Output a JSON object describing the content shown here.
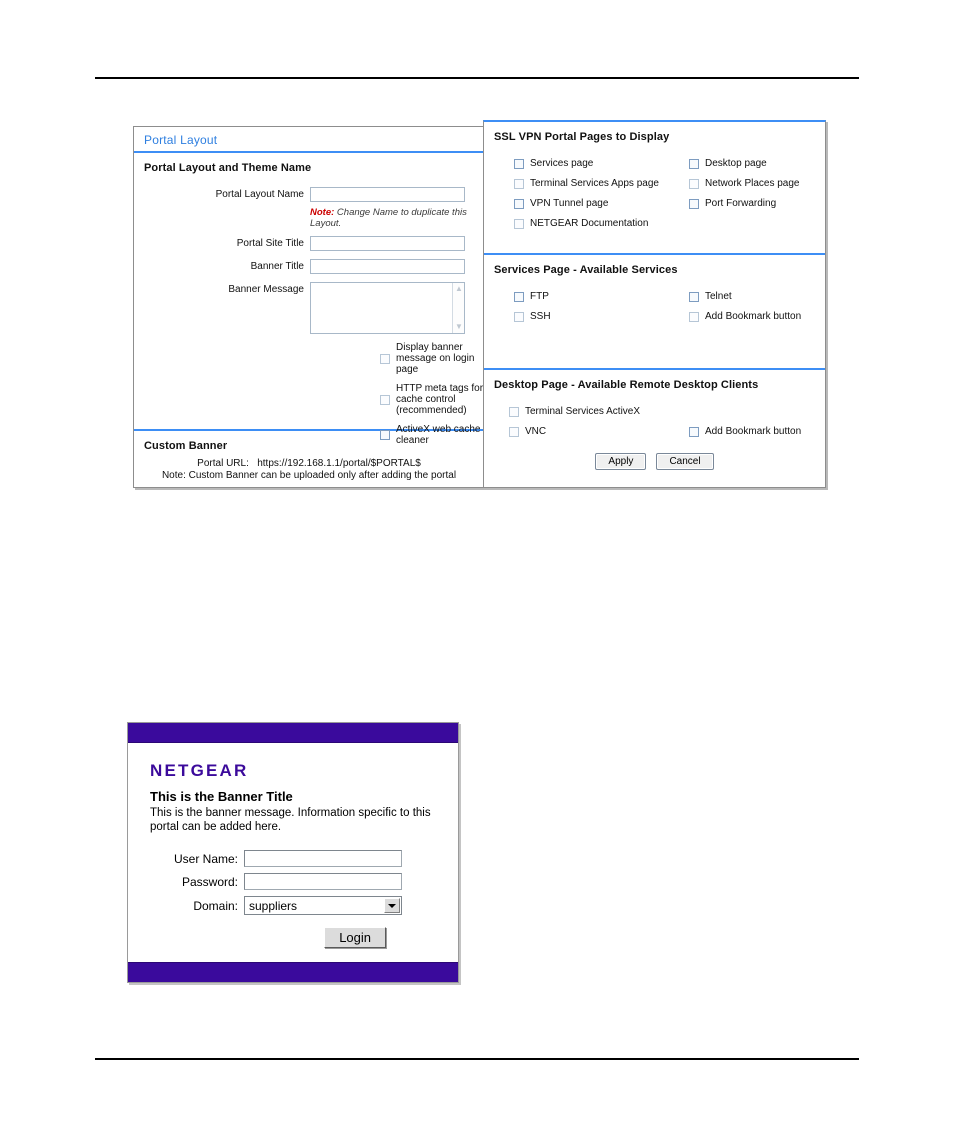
{
  "left_panel": {
    "title": "Portal Layout",
    "sections": [
      {
        "title": "Portal Layout and Theme Name",
        "fields": [
          {
            "label": "Portal Layout Name",
            "value": "",
            "type": "text"
          },
          {
            "label": "Portal Site Title",
            "value": "",
            "type": "text"
          },
          {
            "label": "Banner Title",
            "value": "",
            "type": "text"
          },
          {
            "label": "Banner Message",
            "value": "",
            "type": "textarea"
          }
        ],
        "note_keyword": "Note:",
        "note_text": "Change Name to duplicate this Layout.",
        "checkboxes": [
          {
            "label": "Display banner message on login page",
            "checked": false
          },
          {
            "label": "HTTP meta tags for cache control (recommended)",
            "checked": false
          },
          {
            "label": "ActiveX web cache cleaner",
            "checked": false
          }
        ],
        "portal_url_label": "Portal URL:",
        "portal_url_value": "https://192.168.1.1/portal/$PORTAL$"
      },
      {
        "title": "Custom Banner",
        "note": "Note: Custom Banner can be uploaded only after adding the portal"
      }
    ]
  },
  "right_panel": {
    "sections": [
      {
        "title": "SSL VPN Portal Pages to Display",
        "checkboxes_left": [
          {
            "label": "Services page",
            "checked": false
          },
          {
            "label": "Terminal Services Apps page",
            "checked": false
          },
          {
            "label": "VPN Tunnel page",
            "checked": false
          },
          {
            "label": "NETGEAR Documentation",
            "checked": false
          }
        ],
        "checkboxes_right": [
          {
            "label": "Desktop page",
            "checked": false
          },
          {
            "label": "Network Places page",
            "checked": false
          },
          {
            "label": "Port Forwarding",
            "checked": false
          }
        ]
      },
      {
        "title": "Services Page - Available Services",
        "checkboxes_left": [
          {
            "label": "FTP",
            "checked": false
          },
          {
            "label": "SSH",
            "checked": false
          }
        ],
        "checkboxes_right": [
          {
            "label": "Telnet",
            "checked": false
          },
          {
            "label": "Add Bookmark button",
            "checked": false
          }
        ]
      },
      {
        "title": "Desktop Page - Available Remote Desktop Clients",
        "checkboxes_left": [
          {
            "label": "Terminal Services ActiveX",
            "checked": false
          },
          {
            "label": "VNC",
            "checked": false
          }
        ],
        "checkboxes_right": [
          {
            "label": "",
            "checked": false
          },
          {
            "label": "Add Bookmark button",
            "checked": false
          }
        ]
      }
    ],
    "buttons": {
      "apply": "Apply",
      "cancel": "Cancel"
    }
  },
  "portal_mock": {
    "logo": "NETGEAR",
    "banner_title": "This is the Banner Title",
    "banner_message": "This is the banner message. Information specific to this portal can be added here.",
    "fields": [
      {
        "label": "User Name:",
        "value": ""
      },
      {
        "label": "Password:",
        "value": ""
      }
    ],
    "domain_label": "Domain:",
    "domain_value": "suppliers",
    "login_button": "Login"
  },
  "colors": {
    "panel_accent": "#3d8ef5",
    "title_text": "#2e7fe0",
    "note_red": "#cc0000",
    "netgear_purple": "#3b0a9b",
    "portal_bar": "#3a0a9c"
  }
}
